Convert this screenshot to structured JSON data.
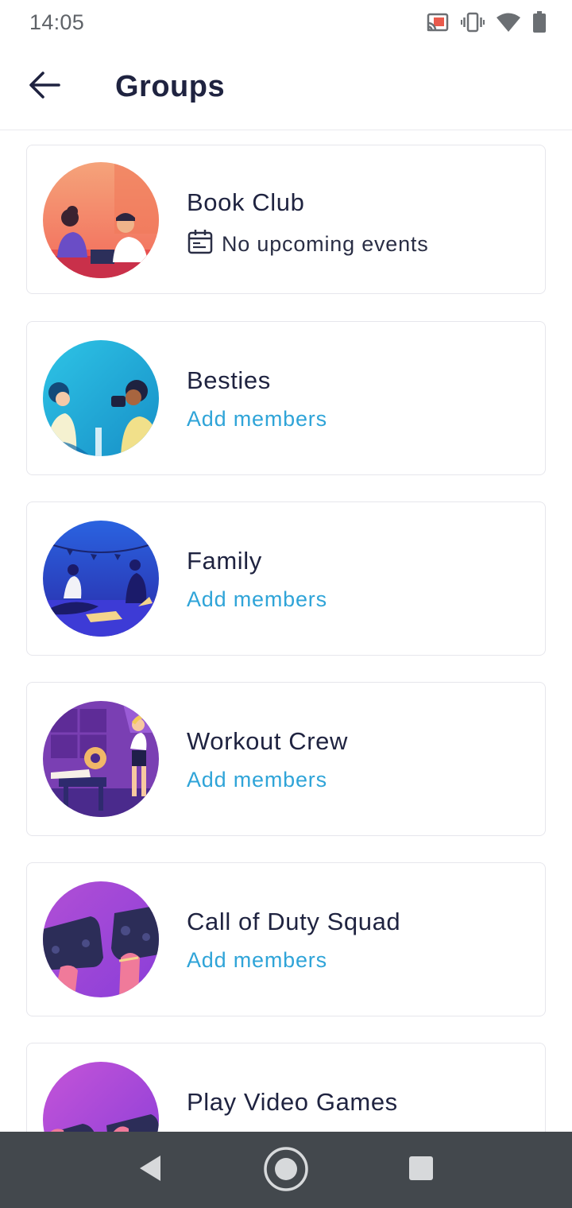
{
  "status_bar": {
    "time": "14:05",
    "icons": [
      "cast-icon",
      "vibrate-icon",
      "wifi-icon",
      "battery-icon"
    ]
  },
  "app_bar": {
    "title": "Groups",
    "back_icon": "arrow-left-icon"
  },
  "groups": [
    {
      "name": "Book Club",
      "subtitle": "No upcoming events",
      "subtitle_type": "events",
      "subtitle_icon": "calendar-icon"
    },
    {
      "name": "Besties",
      "subtitle": "Add members",
      "subtitle_type": "link"
    },
    {
      "name": "Family",
      "subtitle": "Add members",
      "subtitle_type": "link"
    },
    {
      "name": "Workout Crew",
      "subtitle": "Add members",
      "subtitle_type": "link"
    },
    {
      "name": "Call of Duty Squad",
      "subtitle": "Add members",
      "subtitle_type": "link"
    },
    {
      "name": "Play Video Games",
      "subtitle": "",
      "subtitle_type": "hidden"
    }
  ],
  "nav_bar": {
    "icons": [
      "nav-back-icon",
      "nav-home-icon",
      "nav-recents-icon"
    ]
  },
  "colors": {
    "title_text": "#1f2340",
    "link": "#2fa4d8",
    "card_border": "#e6e6ec",
    "nav_bar": "#43484d"
  }
}
